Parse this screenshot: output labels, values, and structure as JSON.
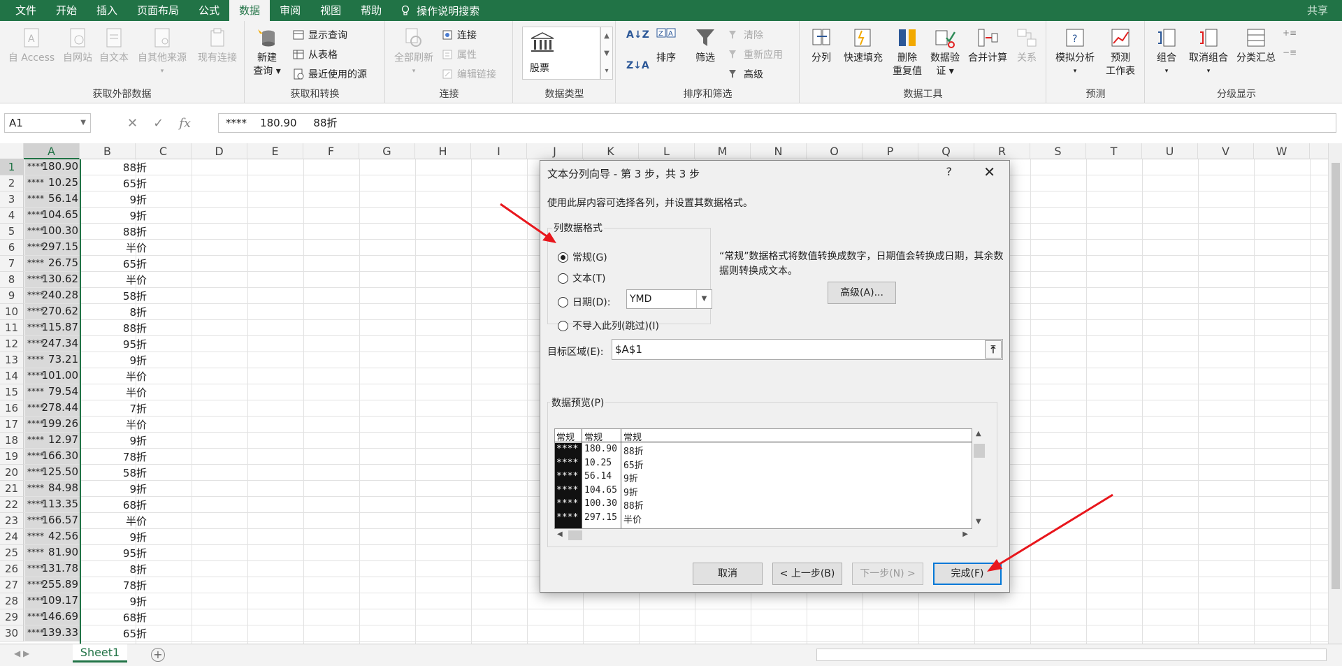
{
  "menubar": {
    "tabs": [
      "文件",
      "开始",
      "插入",
      "页面布局",
      "公式",
      "数据",
      "审阅",
      "视图",
      "帮助"
    ],
    "active_tab": "数据",
    "tell_me": "操作说明搜索",
    "share": "共享"
  },
  "ribbon": {
    "get_external": {
      "title": "获取外部数据",
      "from_access": "自 Access",
      "from_web": "自网站",
      "from_text": "自文本",
      "from_other": "自其他来源",
      "existing": "现有连接"
    },
    "get_transform": {
      "title": "获取和转换",
      "new_query_1": "新建",
      "new_query_2": "查询",
      "show_queries": "显示查询",
      "from_table": "从表格",
      "recent_sources": "最近使用的源"
    },
    "connections": {
      "title": "连接",
      "refresh_all": "全部刷新",
      "connections": "连接",
      "properties": "属性",
      "edit_links": "编辑链接"
    },
    "data_types": {
      "title": "数据类型",
      "stocks": "股票"
    },
    "sort_filter": {
      "title": "排序和筛选",
      "sort": "排序",
      "filter": "筛选",
      "clear": "清除",
      "reapply": "重新应用",
      "advanced": "高级"
    },
    "data_tools": {
      "title": "数据工具",
      "text_to_columns": "分列",
      "flash_fill": "快速填充",
      "remove_dup_1": "删除",
      "remove_dup_2": "重复值",
      "validation_1": "数据验",
      "validation_2": "证",
      "consolidate": "合并计算",
      "relationships": "关系"
    },
    "forecast": {
      "title": "预测",
      "what_if": "模拟分析",
      "forecast_1": "预测",
      "forecast_2": "工作表"
    },
    "outline": {
      "title": "分级显示",
      "group": "组合",
      "ungroup": "取消组合",
      "subtotal": "分类汇总"
    }
  },
  "formula_bar": {
    "name_box": "A1",
    "formula": "****    180.90     88折"
  },
  "columns": [
    "A",
    "B",
    "C",
    "D",
    "E",
    "F",
    "G",
    "H",
    "I",
    "J",
    "K",
    "L",
    "M",
    "N",
    "O",
    "P",
    "Q",
    "R",
    "S",
    "T",
    "U",
    "V",
    "W"
  ],
  "rows": [
    {
      "n": "1",
      "a": "****",
      "num": "180.90",
      "b": "88折"
    },
    {
      "n": "2",
      "a": "****",
      "num": "10.25",
      "b": "65折"
    },
    {
      "n": "3",
      "a": "****",
      "num": "56.14",
      "b": "9折"
    },
    {
      "n": "4",
      "a": "****",
      "num": "104.65",
      "b": "9折"
    },
    {
      "n": "5",
      "a": "****",
      "num": "100.30",
      "b": "88折"
    },
    {
      "n": "6",
      "a": "****",
      "num": "297.15",
      "b": "半价"
    },
    {
      "n": "7",
      "a": "****",
      "num": "26.75",
      "b": "65折"
    },
    {
      "n": "8",
      "a": "****",
      "num": "130.62",
      "b": "半价"
    },
    {
      "n": "9",
      "a": "****",
      "num": "240.28",
      "b": "58折"
    },
    {
      "n": "10",
      "a": "****",
      "num": "270.62",
      "b": "8折"
    },
    {
      "n": "11",
      "a": "****",
      "num": "115.87",
      "b": "88折"
    },
    {
      "n": "12",
      "a": "****",
      "num": "247.34",
      "b": "95折"
    },
    {
      "n": "13",
      "a": "****",
      "num": "73.21",
      "b": "9折"
    },
    {
      "n": "14",
      "a": "****",
      "num": "101.00",
      "b": "半价"
    },
    {
      "n": "15",
      "a": "****",
      "num": "79.54",
      "b": "半价"
    },
    {
      "n": "16",
      "a": "****",
      "num": "278.44",
      "b": "7折"
    },
    {
      "n": "17",
      "a": "****",
      "num": "199.26",
      "b": "半价"
    },
    {
      "n": "18",
      "a": "****",
      "num": "12.97",
      "b": "9折"
    },
    {
      "n": "19",
      "a": "****",
      "num": "166.30",
      "b": "78折"
    },
    {
      "n": "20",
      "a": "****",
      "num": "125.50",
      "b": "58折"
    },
    {
      "n": "21",
      "a": "****",
      "num": "84.98",
      "b": "9折"
    },
    {
      "n": "22",
      "a": "****",
      "num": "113.35",
      "b": "68折"
    },
    {
      "n": "23",
      "a": "****",
      "num": "166.57",
      "b": "半价"
    },
    {
      "n": "24",
      "a": "****",
      "num": "42.56",
      "b": "9折"
    },
    {
      "n": "25",
      "a": "****",
      "num": "81.90",
      "b": "95折"
    },
    {
      "n": "26",
      "a": "****",
      "num": "131.78",
      "b": "8折"
    },
    {
      "n": "27",
      "a": "****",
      "num": "255.89",
      "b": "78折"
    },
    {
      "n": "28",
      "a": "****",
      "num": "109.17",
      "b": "9折"
    },
    {
      "n": "29",
      "a": "****",
      "num": "146.69",
      "b": "68折"
    },
    {
      "n": "30",
      "a": "****",
      "num": "139.33",
      "b": "65折"
    }
  ],
  "sheet_tab": "Sheet1",
  "dialog": {
    "title": "文本分列向导 - 第 3 步，共 3 步",
    "help": "?",
    "close": "✕",
    "intro": "使用此屏内容可选择各列，并设置其数据格式。",
    "format_group": "列数据格式",
    "radio_general": "常规(G)",
    "radio_text": "文本(T)",
    "radio_date": "日期(D):",
    "radio_skip": "不导入此列(跳过)(I)",
    "date_value": "YMD",
    "description": "“常规”数据格式将数值转换成数字，日期值会转换成日期，其余数据则转换成文本。",
    "advanced": "高级(A)...",
    "dest_label": "目标区域(E):",
    "dest_value": "$A$1",
    "preview_label": "数据预览(P)",
    "preview_headers": [
      "常规",
      "常规",
      "常规"
    ],
    "preview_rows": [
      [
        "****",
        "180.90",
        "88折"
      ],
      [
        "****",
        "10.25",
        "65折"
      ],
      [
        "****",
        "56.14",
        "9折"
      ],
      [
        "****",
        "104.65",
        "9折"
      ],
      [
        "****",
        "100.30",
        "88折"
      ],
      [
        "****",
        "297.15",
        "半价"
      ]
    ],
    "cancel": "取消",
    "back": "< 上一步(B)",
    "next": "下一步(N) >",
    "finish": "完成(F)"
  },
  "colors": {
    "excel_green": "#217346",
    "annotation_red": "#e8161c",
    "focus_blue": "#0078d7"
  }
}
